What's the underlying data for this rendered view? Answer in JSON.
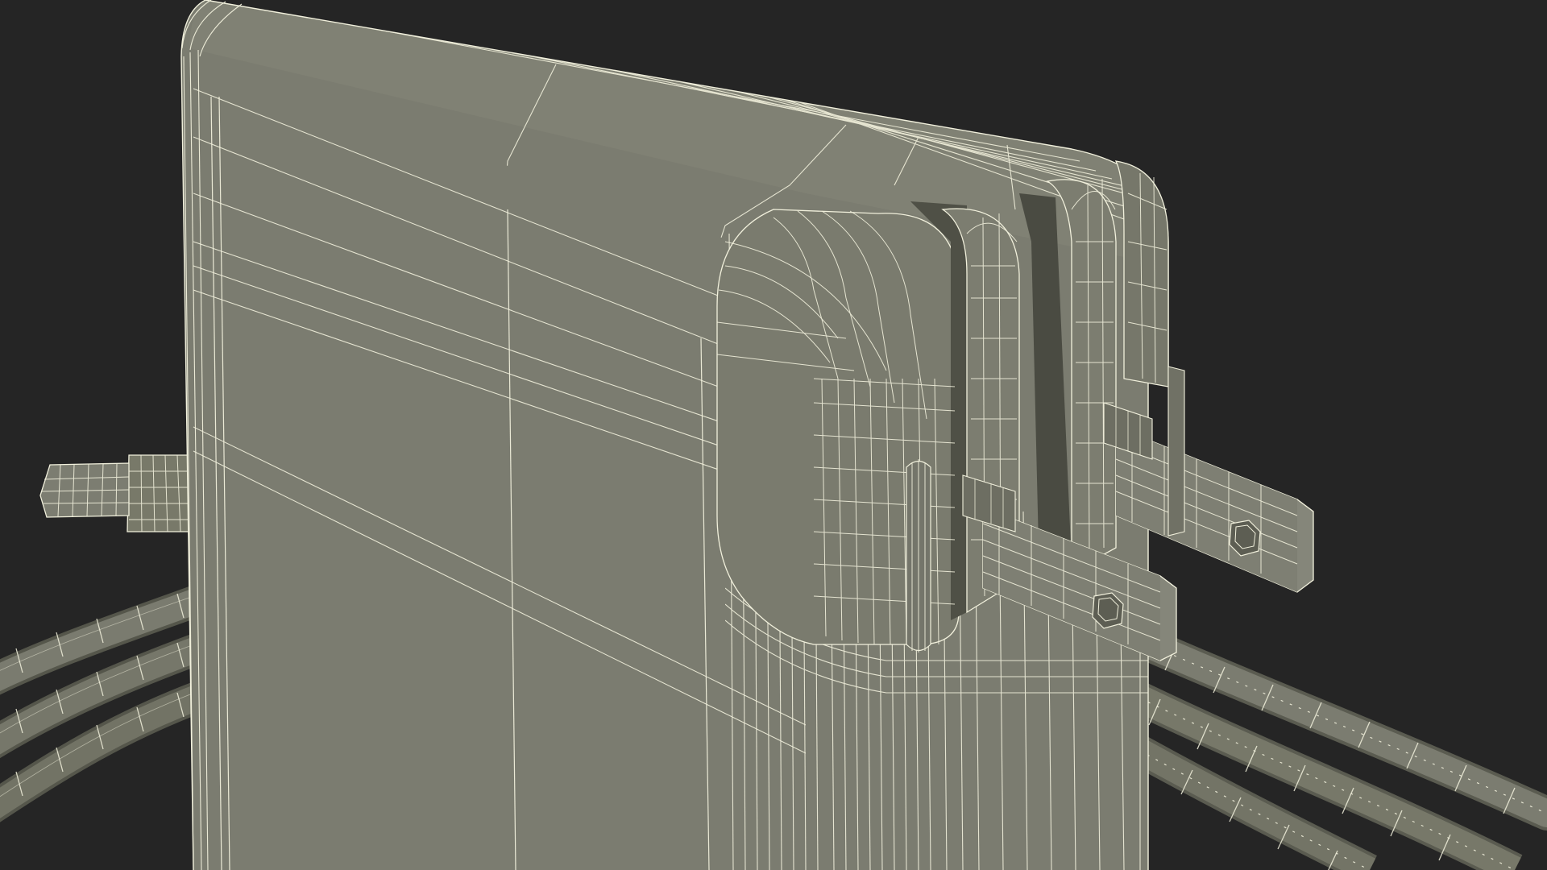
{
  "scene": {
    "subject": "usb-c-power-adapter-wireframe",
    "view": "wireframe"
  },
  "colors": {
    "background": "#252525",
    "surface": "#7b7c70",
    "surface_dark": "#636457",
    "surface_shadow": "#4e4f45",
    "wire": "#f1f0dc"
  }
}
